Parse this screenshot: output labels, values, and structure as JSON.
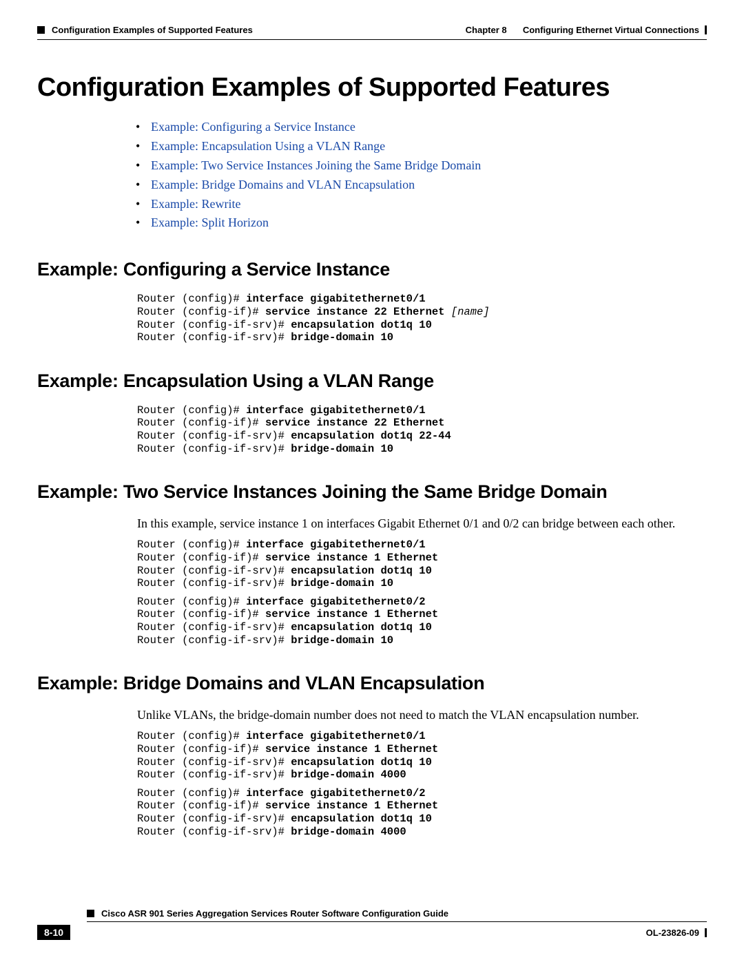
{
  "header": {
    "section": "Configuration Examples of Supported Features",
    "chapter_label": "Chapter 8",
    "chapter_title": "Configuring Ethernet Virtual Connections"
  },
  "title": "Configuration Examples of Supported Features",
  "toc": [
    "Example: Configuring a Service Instance",
    "Example: Encapsulation Using a VLAN Range",
    "Example: Two Service Instances Joining the Same Bridge Domain",
    "Example: Bridge Domains and VLAN Encapsulation",
    "Example: Rewrite",
    "Example: Split Horizon"
  ],
  "sections": {
    "s1": {
      "heading": "Example: Configuring a Service Instance",
      "code": [
        {
          "p": "Router (config)# ",
          "b": "interface gigabitethernet0/1"
        },
        {
          "p": "Router (config-if)# ",
          "b": "service instance 22 Ethernet ",
          "i": "[name]"
        },
        {
          "p": "Router (config-if-srv)# ",
          "b": "encapsulation dot1q 10"
        },
        {
          "p": "Router (config-if-srv)# ",
          "b": "bridge-domain 10"
        }
      ]
    },
    "s2": {
      "heading": "Example: Encapsulation Using a VLAN Range",
      "code": [
        {
          "p": "Router (config)# ",
          "b": "interface gigabitethernet0/1"
        },
        {
          "p": "Router (config-if)# ",
          "b": "service instance 22 Ethernet"
        },
        {
          "p": "Router (config-if-srv)# ",
          "b": "encapsulation dot1q 22-44"
        },
        {
          "p": "Router (config-if-srv)# ",
          "b": "bridge-domain 10"
        }
      ]
    },
    "s3": {
      "heading": "Example: Two Service Instances Joining the Same Bridge Domain",
      "intro": "In this example, service instance 1 on interfaces Gigabit Ethernet 0/1 and 0/2 can bridge between each other.",
      "code_a": [
        {
          "p": "Router (config)# ",
          "b": "interface gigabitethernet0/1"
        },
        {
          "p": "Router (config-if)# ",
          "b": "service instance 1 Ethernet"
        },
        {
          "p": "Router (config-if-srv)# ",
          "b": "encapsulation dot1q 10"
        },
        {
          "p": "Router (config-if-srv)# ",
          "b": "bridge-domain 10"
        }
      ],
      "code_b": [
        {
          "p": "Router (config)# ",
          "b": "interface gigabitethernet0/2"
        },
        {
          "p": "Router (config-if)# ",
          "b": "service instance 1 Ethernet"
        },
        {
          "p": "Router (config-if-srv)# ",
          "b": "encapsulation dot1q 10"
        },
        {
          "p": "Router (config-if-srv)# ",
          "b": "bridge-domain 10"
        }
      ]
    },
    "s4": {
      "heading": "Example: Bridge Domains and VLAN Encapsulation",
      "intro": "Unlike VLANs, the bridge-domain number does not need to match the VLAN encapsulation number.",
      "code_a": [
        {
          "p": "Router (config)# ",
          "b": "interface gigabitethernet0/1"
        },
        {
          "p": "Router (config-if)# ",
          "b": "service instance 1 Ethernet"
        },
        {
          "p": "Router (config-if-srv)# ",
          "b": "encapsulation dot1q 10"
        },
        {
          "p": "Router (config-if-srv)# ",
          "b": "bridge-domain 4000"
        }
      ],
      "code_b": [
        {
          "p": "Router (config)# ",
          "b": "interface gigabitethernet0/2"
        },
        {
          "p": "Router (config-if)# ",
          "b": "service instance 1 Ethernet"
        },
        {
          "p": "Router (config-if-srv)# ",
          "b": "encapsulation dot1q 10"
        },
        {
          "p": "Router (config-if-srv)# ",
          "b": "bridge-domain 4000"
        }
      ]
    }
  },
  "footer": {
    "book": "Cisco ASR 901 Series Aggregation Services Router Software Configuration Guide",
    "page": "8-10",
    "docnum": "OL-23826-09"
  }
}
